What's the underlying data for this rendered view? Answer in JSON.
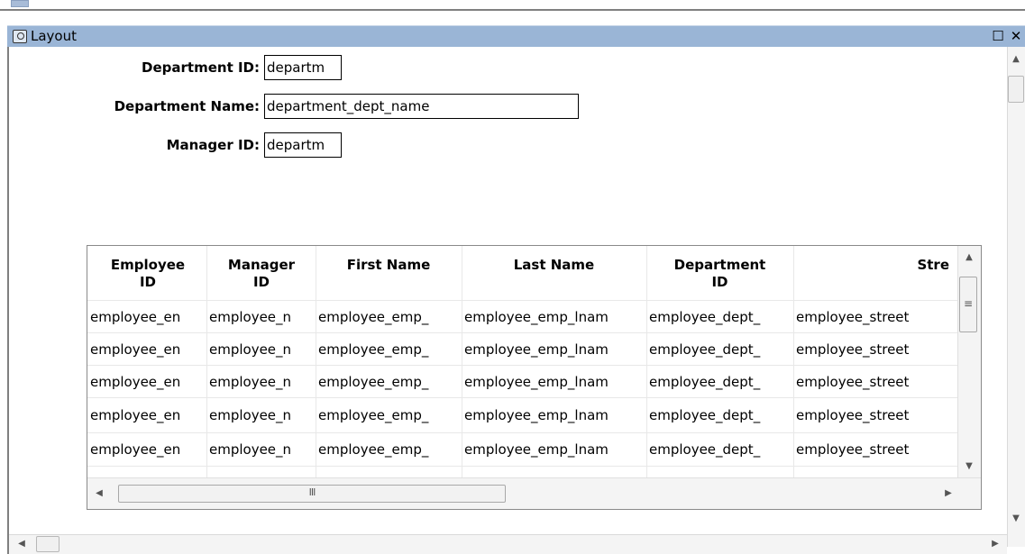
{
  "window": {
    "title": "Layout",
    "maximize_glyph": "☐",
    "close_glyph": "✕"
  },
  "form": {
    "department_id": {
      "label": "Department ID:",
      "value": "departm"
    },
    "department_name": {
      "label": "Department Name:",
      "value": "department_dept_name"
    },
    "manager_id": {
      "label": "Manager ID:",
      "value": "departm"
    }
  },
  "grid": {
    "columns": [
      {
        "line1": "Employee",
        "line2": "ID"
      },
      {
        "line1": "Manager",
        "line2": "ID"
      },
      {
        "line1": "First Name",
        "line2": ""
      },
      {
        "line1": "Last Name",
        "line2": ""
      },
      {
        "line1": "Department",
        "line2": "ID"
      },
      {
        "line1": "Stre",
        "line2": ""
      }
    ],
    "rows": [
      [
        "employee_en",
        "employee_n",
        "employee_emp_",
        "employee_emp_lnam",
        "employee_dept_",
        "employee_street"
      ],
      [
        "employee_en",
        "employee_n",
        "employee_emp_",
        "employee_emp_lnam",
        "employee_dept_",
        "employee_street"
      ],
      [
        "employee_en",
        "employee_n",
        "employee_emp_",
        "employee_emp_lnam",
        "employee_dept_",
        "employee_street"
      ],
      [
        "employee_en",
        "employee_n",
        "employee_emp_",
        "employee_emp_lnam",
        "employee_dept_",
        "employee_street"
      ],
      [
        "employee_en",
        "employee_n",
        "employee_emp_",
        "employee_emp_lnam",
        "employee_dept_",
        "employee_street"
      ]
    ],
    "hscroll_grip": "III"
  },
  "icons": {
    "title": "layout-window-icon",
    "maximize": "maximize-icon",
    "close": "close-icon",
    "scroll_up": "▲",
    "scroll_down": "▼",
    "scroll_left": "◀",
    "scroll_right": "▶",
    "vgrip": "≡"
  }
}
